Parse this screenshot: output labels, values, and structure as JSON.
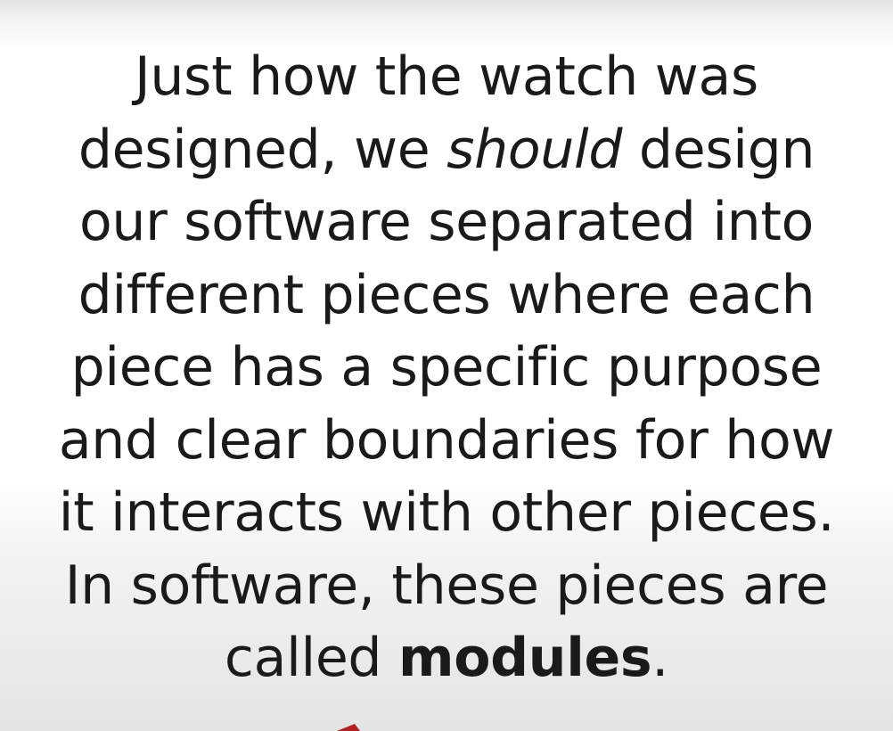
{
  "slide": {
    "lines": [
      {
        "text": "Just how the watch was"
      },
      {
        "before": "designed, we ",
        "italic": "should",
        "after": " design"
      },
      {
        "text": "our software separated into"
      },
      {
        "text": "different pieces where each"
      },
      {
        "text": "piece has a specific purpose"
      },
      {
        "text": "and clear boundaries for how"
      },
      {
        "text": "it interacts with other pieces."
      },
      {
        "text": "In software, these pieces are"
      },
      {
        "before": "called ",
        "bold": "modules",
        "after": "."
      }
    ],
    "accent_color": "#b3201f"
  }
}
